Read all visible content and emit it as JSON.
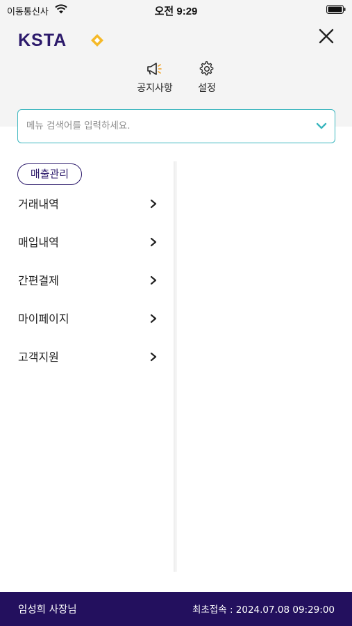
{
  "status_bar": {
    "carrier": "이동통신사",
    "time": "오전 9:29"
  },
  "header": {
    "logo_text": "KSTA"
  },
  "quick_menu": {
    "notice": "공지사항",
    "settings": "설정"
  },
  "search": {
    "placeholder": "메뉴 검색어를 입력하세요.",
    "value": ""
  },
  "menu": {
    "category": "매출관리",
    "items": [
      {
        "label": "거래내역"
      },
      {
        "label": "매입내역"
      },
      {
        "label": "간편결제"
      },
      {
        "label": "마이페이지"
      },
      {
        "label": "고객지원"
      }
    ]
  },
  "footer": {
    "user": "임성희 사장님",
    "last_login": "최초접속 : 2024.07.08 09:29:00"
  },
  "colors": {
    "accent": "#3ab6be",
    "brand": "#2c1a6b",
    "footer_bg": "#23105e",
    "logo_diamond": "#f5b928"
  }
}
